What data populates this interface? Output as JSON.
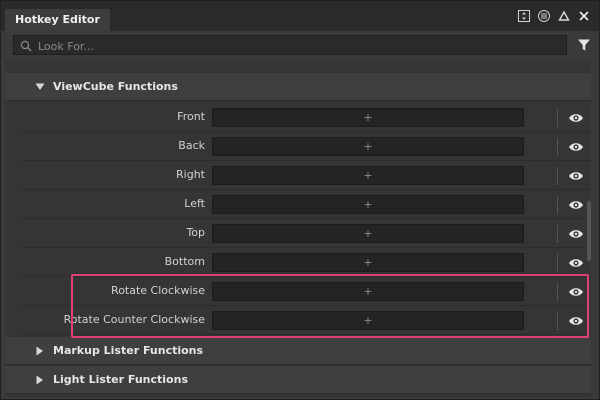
{
  "window": {
    "title": "Hotkey Editor"
  },
  "search": {
    "placeholder": "Look For...",
    "value": ""
  },
  "groups": {
    "viewcube": {
      "label": "ViewCube Functions",
      "expanded": true
    },
    "markup": {
      "label": "Markup Lister Functions",
      "expanded": false
    },
    "light": {
      "label": "Light Lister Functions",
      "expanded": false
    }
  },
  "rows": [
    {
      "label": "Front",
      "hotkey": "+"
    },
    {
      "label": "Back",
      "hotkey": "+"
    },
    {
      "label": "Right",
      "hotkey": "+"
    },
    {
      "label": "Left",
      "hotkey": "+"
    },
    {
      "label": "Top",
      "hotkey": "+"
    },
    {
      "label": "Bottom",
      "hotkey": "+"
    },
    {
      "label": "Rotate Clockwise",
      "hotkey": "+"
    },
    {
      "label": "Rotate Counter Clockwise",
      "hotkey": "+"
    }
  ],
  "colors": {
    "highlight": "#e0407a"
  }
}
